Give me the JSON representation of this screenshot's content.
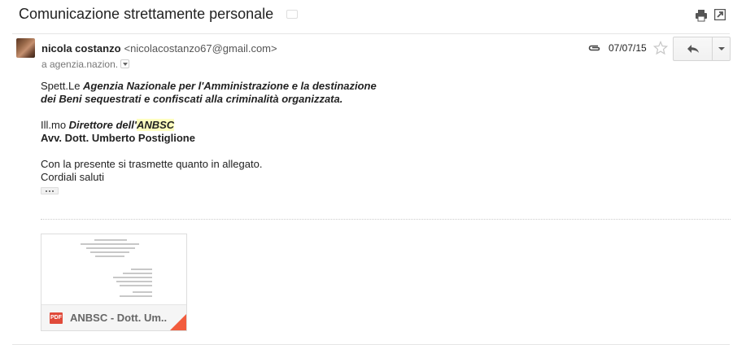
{
  "subject": "Comunicazione strettamente personale",
  "message": {
    "sender_name": "nicola costanzo",
    "sender_email": "<nicolacostanzo67@gmail.com>",
    "recipient": "a agenzia.nazion.",
    "date": "07/07/15",
    "body": {
      "salutation_prefix": "Spett.Le ",
      "salutation_line1": "Agenzia Nazionale per l'Amministrazione e la destinazione",
      "salutation_line2": "dei Beni sequestrati e confiscati alla criminalità organizzata.",
      "director_prefix": "Ill.mo ",
      "director_title": "Direttore dell'",
      "director_org": "ANBSC",
      "director_name": "Avv. Dott. Umberto Postiglione",
      "text_line1": "Con la presente si trasmette quanto in allegato.",
      "text_line2": "Cordiali saluti"
    }
  },
  "attachment": {
    "type_label": "PDF",
    "name": "ANBSC - Dott. Um.."
  },
  "colors": {
    "highlight": "#ffffc0",
    "pdf_red": "#e04a3a",
    "corner_orange": "#f25c3d"
  },
  "icons": [
    "print-icon",
    "popout-icon",
    "paperclip-icon",
    "star-icon",
    "reply-icon",
    "chevron-down-icon",
    "pdf-icon"
  ]
}
